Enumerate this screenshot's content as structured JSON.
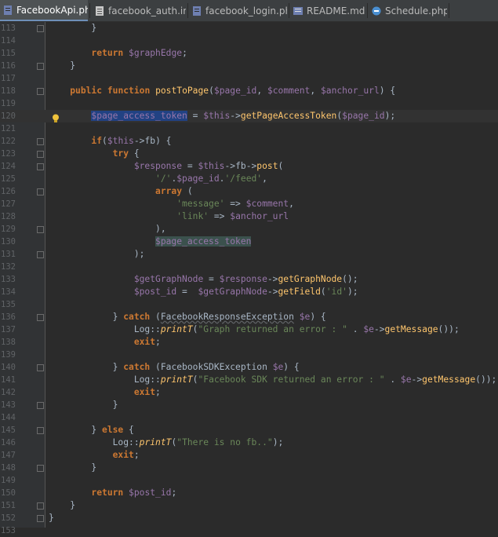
{
  "tabs": [
    {
      "label": "FacebookApi.php",
      "active": true,
      "icon": "php-file-icon"
    },
    {
      "label": "facebook_auth.ini",
      "active": false,
      "icon": "ini-file-icon"
    },
    {
      "label": "facebook_login.php",
      "active": false,
      "icon": "php-file-icon"
    },
    {
      "label": "README.md",
      "active": false,
      "icon": "markdown-file-icon"
    },
    {
      "label": "Schedule.php",
      "active": false,
      "icon": "php-class-icon"
    }
  ],
  "tab_close_glyph": "×",
  "editor": {
    "caret_line": 120,
    "lines": [
      {
        "n": "113",
        "code": "        }"
      },
      {
        "n": "114",
        "code": ""
      },
      {
        "n": "115",
        "code": "        return $graphEdge;"
      },
      {
        "n": "116",
        "code": "    }"
      },
      {
        "n": "117",
        "code": ""
      },
      {
        "n": "118",
        "code": "    public function postToPage($page_id, $comment, $anchor_url) {"
      },
      {
        "n": "119",
        "code": ""
      },
      {
        "n": "120",
        "code": "        $page_access_token = $this->getPageAccessToken($page_id);"
      },
      {
        "n": "121",
        "code": ""
      },
      {
        "n": "122",
        "code": "        if($this->fb) {"
      },
      {
        "n": "123",
        "code": "            try {"
      },
      {
        "n": "124",
        "code": "                $response = $this->fb->post("
      },
      {
        "n": "125",
        "code": "                    '/'.$page_id.'/feed',"
      },
      {
        "n": "126",
        "code": "                    array ("
      },
      {
        "n": "127",
        "code": "                        'message' => $comment,"
      },
      {
        "n": "128",
        "code": "                        'link' => $anchor_url"
      },
      {
        "n": "129",
        "code": "                    ),"
      },
      {
        "n": "130",
        "code": "                    $page_access_token"
      },
      {
        "n": "131",
        "code": "                );"
      },
      {
        "n": "132",
        "code": ""
      },
      {
        "n": "133",
        "code": "                $getGraphNode = $response->getGraphNode();"
      },
      {
        "n": "134",
        "code": "                $post_id =  $getGraphNode->getField('id');"
      },
      {
        "n": "135",
        "code": ""
      },
      {
        "n": "136",
        "code": "            } catch (FacebookResponseException $e) {"
      },
      {
        "n": "137",
        "code": "                Log::printT(\"Graph returned an error : \" . $e->getMessage());"
      },
      {
        "n": "138",
        "code": "                exit;"
      },
      {
        "n": "139",
        "code": ""
      },
      {
        "n": "140",
        "code": "            } catch (FacebookSDKException $e) {"
      },
      {
        "n": "141",
        "code": "                Log::printT(\"Facebook SDK returned an error : \" . $e->getMessage());"
      },
      {
        "n": "142",
        "code": "                exit;"
      },
      {
        "n": "143",
        "code": "            }"
      },
      {
        "n": "144",
        "code": ""
      },
      {
        "n": "145",
        "code": "        } else {"
      },
      {
        "n": "146",
        "code": "            Log::printT(\"There is no fb..\");"
      },
      {
        "n": "147",
        "code": "            exit;"
      },
      {
        "n": "148",
        "code": "        }"
      },
      {
        "n": "149",
        "code": ""
      },
      {
        "n": "150",
        "code": "        return $post_id;"
      },
      {
        "n": "151",
        "code": "    }"
      },
      {
        "n": "152",
        "code": "}"
      },
      {
        "n": "153",
        "code": ""
      }
    ]
  },
  "colors": {
    "background": "#2b2b2b",
    "keyword": "#cc7832",
    "variable": "#9876aa",
    "function": "#ffc66d",
    "string": "#6a8759",
    "text": "#a9b7c6",
    "selection": "#214283"
  }
}
